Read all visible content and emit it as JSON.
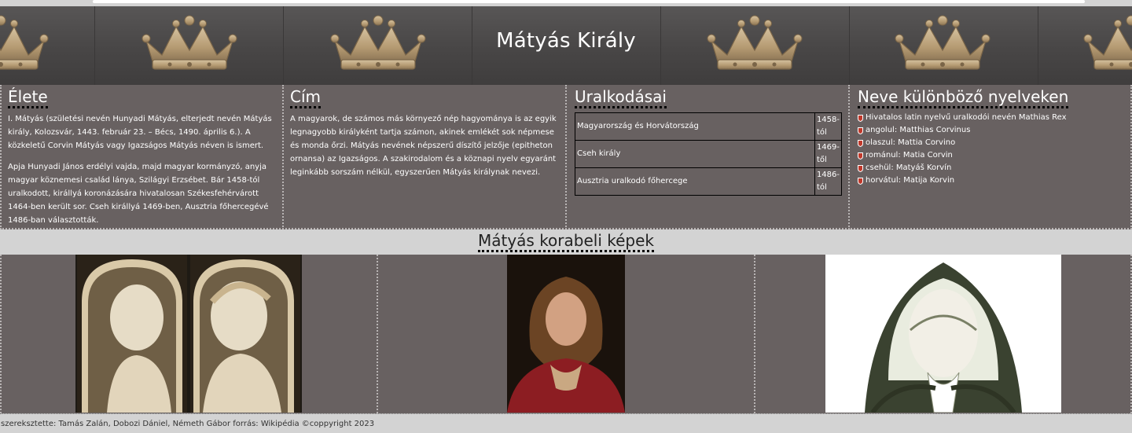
{
  "header": {
    "title": "Mátyás Király"
  },
  "colors": {
    "banner_bg": "#4b4949",
    "panel_bg": "#686161",
    "page_bg": "#d3d3d3",
    "crown_gold": "#bfa57e"
  },
  "sections": {
    "life": {
      "title": "Élete",
      "paragraphs": [
        "I. Mátyás (születési nevén Hunyadi Mátyás, elterjedt nevén Mátyás király, Kolozsvár, 1443. február 23. – Bécs, 1490. április 6.). A közkeletű Corvin Mátyás vagy Igazságos Mátyás néven is ismert.",
        "Apja Hunyadi János erdélyi vajda, majd magyar kormányzó, anyja magyar köznemesi család lánya, Szilágyi Erzsébet. Bár 1458-tól uralkodott, királlyá koronázására hivatalosan Székesfehérvárott 1464-ben került sor. Cseh királlyá 1469-ben, Ausztria főhercegévé 1486-ban választották."
      ]
    },
    "title_section": {
      "title": "Cím",
      "paragraph": "A magyarok, de számos más környező nép hagyománya is az egyik legnagyobb királyként tartja számon, akinek emlékét sok népmese és monda őrzi. Mátyás nevének népszerű díszítő jelzője (epitheton ornansa) az Igazságos. A szakirodalom és a köznapi nyelv egyaránt leginkább sorszám nélkül, egyszerűen Mátyás királynak nevezi."
    },
    "reigns": {
      "title": "Uralkodásai",
      "rows": [
        {
          "name": "Magyarország és Horvátország",
          "from": "1458-tól"
        },
        {
          "name": "Cseh király",
          "from": "1469-től"
        },
        {
          "name": "Ausztria uralkodó főhercege",
          "from": "1486-tól"
        }
      ]
    },
    "names": {
      "title": "Neve különböző nyelveken",
      "items": [
        "Hivatalos latin nyelvű uralkodói nevén Mathias Rex",
        "angolul: Matthias Corvinus",
        "olaszul: Mattia Corvino",
        "románul: Matia Corvin",
        "csehül: Matyáš Korvín",
        "horvátul: Matija Korvin"
      ],
      "bullet_icon": "shield-icon"
    }
  },
  "gallery": {
    "title": "Mátyás korabeli képek"
  },
  "footer": {
    "text": "szereksztette: Tamás Zalán, Dobozi Dániel, Németh Gábor forrás: Wikipédia ©coppyright 2023"
  }
}
